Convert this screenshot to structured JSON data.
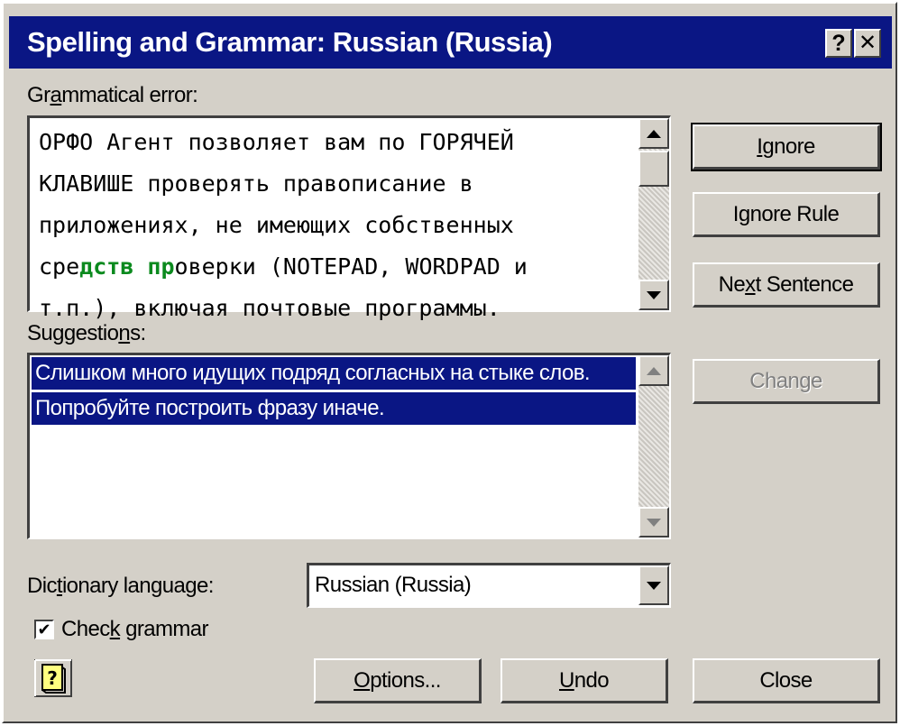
{
  "window": {
    "title": "Spelling and Grammar: Russian (Russia)",
    "help_glyph": "?",
    "close_glyph": "✕"
  },
  "error_section": {
    "label_pre": "Gr",
    "label_u": "a",
    "label_post": "mmatical error:",
    "lines": [
      {
        "text": "ОРФО Агент позволяет вам по ГОРЯЧЕЙ"
      },
      {
        "text": "КЛАВИШЕ проверять правописание в"
      },
      {
        "text": "приложениях, не имеющих собственных"
      },
      {
        "pre": "сре",
        "highlight": "дств пр",
        "post": "оверки (NOTEPAD, WORDPAD и"
      },
      {
        "text": "т.п.), включая почтовые программы."
      }
    ],
    "highlight_color": "#0b8a1e"
  },
  "suggestions_section": {
    "label_pre": "Suggestio",
    "label_u": "n",
    "label_post": "s:",
    "items": [
      "Слишком много идущих подряд согласных на стыке слов.",
      "Попробуйте построить фразу иначе."
    ]
  },
  "buttons": {
    "ignore": {
      "pre": "",
      "u": "I",
      "post": "gnore"
    },
    "ignore_rule": {
      "pre": "I",
      "u": "g",
      "post": "nore Rule"
    },
    "next_sentence": {
      "pre": "Ne",
      "u": "x",
      "post": "t Sentence"
    },
    "change": "Change",
    "options": {
      "pre": "",
      "u": "O",
      "post": "ptions..."
    },
    "undo": {
      "pre": "",
      "u": "U",
      "post": "ndo"
    },
    "close": "Close"
  },
  "dictionary": {
    "label_pre": "Dic",
    "label_u": "t",
    "label_post": "ionary language:",
    "selected": "Russian (Russia)"
  },
  "check_grammar": {
    "checked": true,
    "mark": "✔",
    "label_pre": "Chec",
    "label_u": "k",
    "label_post": " grammar"
  },
  "icons": {
    "help_book": "help-book-icon"
  },
  "colors": {
    "title_bar": "#0a1684",
    "selection": "#0a1684",
    "face": "#d4d0c8"
  }
}
